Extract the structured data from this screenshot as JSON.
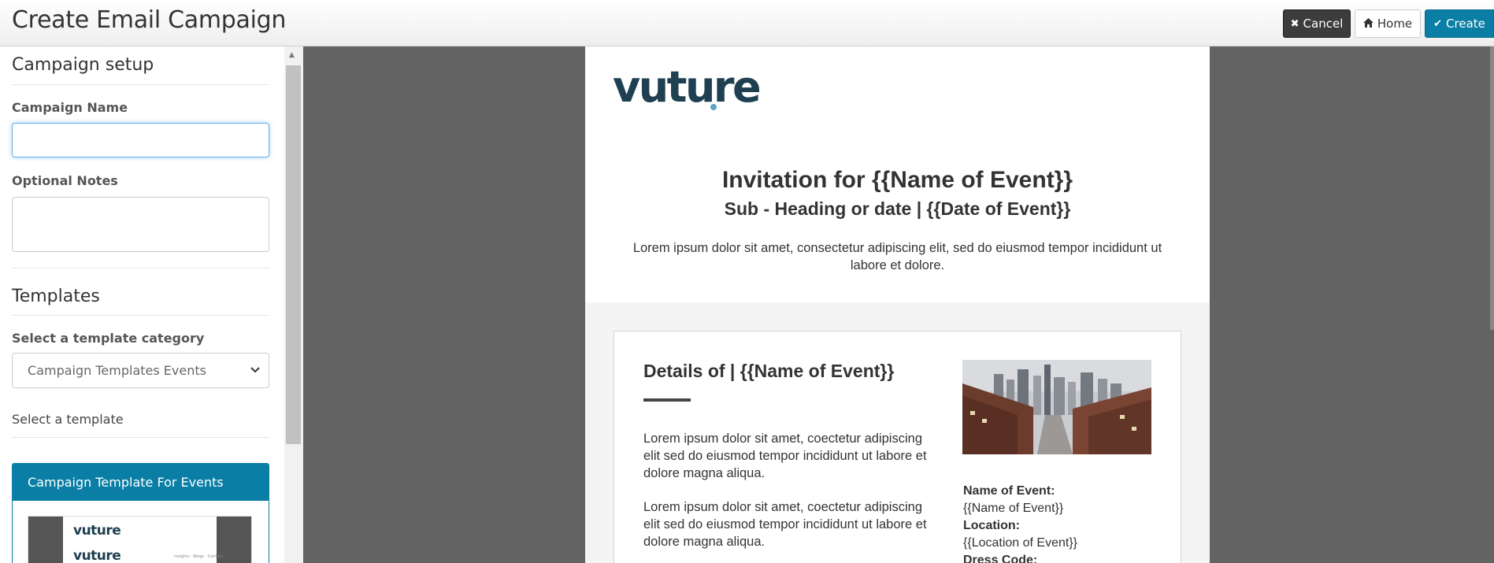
{
  "header": {
    "title": "Create Email Campaign",
    "cancel_label": "Cancel",
    "home_label": "Home",
    "create_label": "Create"
  },
  "sidebar": {
    "setup_title": "Campaign setup",
    "campaign_name_label": "Campaign Name",
    "campaign_name_value": "",
    "notes_label": "Optional Notes",
    "notes_value": "",
    "templates_title": "Templates",
    "category_label": "Select a template category",
    "category_selected": "Campaign Templates Events",
    "select_template_label": "Select a template",
    "template_card": {
      "name": "Campaign Template For Events",
      "thumb_logo_1": "vuture",
      "thumb_logo_2": "vuture",
      "thumb_links": "Insights  ·  Blogs  ·  Contact"
    }
  },
  "preview": {
    "logo": "vuture",
    "title": "Invitation for {{Name of Event}}",
    "subtitle": "Sub - Heading or date | {{Date of Event}}",
    "intro": "Lorem ipsum dolor sit amet, consectetur adipiscing elit, sed do eiusmod tempor incididunt ut labore et dolore.",
    "details_title": "Details of | {{Name of Event}}",
    "para1": "Lorem ipsum dolor sit amet, coectetur adipiscing elit sed do eiusmod tempor incididunt ut labore et dolore magna aliqua.",
    "para2": "Lorem ipsum dolor sit amet, coectetur adipiscing elit sed do eiusmod tempor incididunt ut labore et dolore magna aliqua.",
    "info": {
      "name_label": "Name of Event:",
      "name_value": "{{Name of Event}}",
      "location_label": "Location:",
      "location_value": "{{Location of Event}}",
      "dress_label": "Dress Code:"
    }
  },
  "colors": {
    "accent": "#0a7ea4",
    "preview_bg": "#636363",
    "logo": "#1f4050",
    "logo_dot": "#5ba3c7"
  },
  "icons": {
    "cancel": "close-icon",
    "home": "home-icon",
    "create": "check-icon",
    "select": "chevron-down-icon"
  }
}
